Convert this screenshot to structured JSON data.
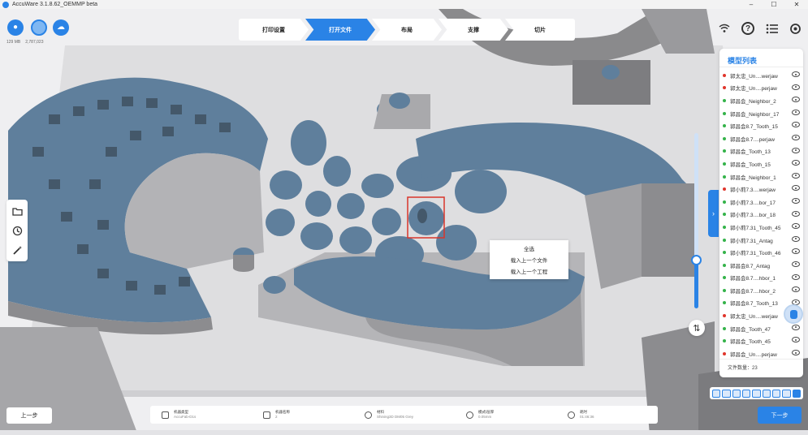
{
  "window": {
    "title": "AccuWare 3.1.8.62_OEMMP beta",
    "controls": [
      "–",
      "☐",
      "✕"
    ]
  },
  "account": {
    "memory": "129 MB",
    "triangles": "2,787,023"
  },
  "steps": [
    {
      "label": "打印设置",
      "active": false
    },
    {
      "label": "打开文件",
      "active": true
    },
    {
      "label": "布局",
      "active": false
    },
    {
      "label": "支撑",
      "active": false
    },
    {
      "label": "切片",
      "active": false
    }
  ],
  "top_right_icons": [
    "wifi-icon",
    "help-icon",
    "list-icon",
    "settings-icon"
  ],
  "left_tools": [
    "folder-icon",
    "history-icon",
    "magic-wand-icon"
  ],
  "context_menu": {
    "items": [
      "全选",
      "载入上一个文件",
      "载入上一个工程"
    ]
  },
  "model_list": {
    "title": "模型列表",
    "items": [
      {
        "name": "郭太忠_Un....werjaw",
        "status": "red"
      },
      {
        "name": "郭太忠_Un....perjaw",
        "status": "red"
      },
      {
        "name": "郭昌会_Neighbor_2",
        "status": "green"
      },
      {
        "name": "郭昌会_Neighbor_17",
        "status": "green"
      },
      {
        "name": "郭昌会8.7_Tooth_15",
        "status": "green"
      },
      {
        "name": "郭昌会8.7....perjaw",
        "status": "green"
      },
      {
        "name": "郭昌会_Tooth_13",
        "status": "green"
      },
      {
        "name": "郭昌会_Tooth_15",
        "status": "green"
      },
      {
        "name": "郭昌会_Neighbor_1",
        "status": "green"
      },
      {
        "name": "郭小莉7.3....werjaw",
        "status": "red"
      },
      {
        "name": "郭小莉7.3....bor_17",
        "status": "green"
      },
      {
        "name": "郭小莉7.3....bor_18",
        "status": "green"
      },
      {
        "name": "郭小莉7.31_Tooth_45",
        "status": "green"
      },
      {
        "name": "郭小莉7.31_Antag",
        "status": "green"
      },
      {
        "name": "郭小莉7.31_Tooth_46",
        "status": "green"
      },
      {
        "name": "郭昌会8.7_Antag",
        "status": "green"
      },
      {
        "name": "郭昌会8.7....hbor_1",
        "status": "green"
      },
      {
        "name": "郭昌会8.7....hbor_2",
        "status": "green"
      },
      {
        "name": "郭昌会8.7_Tooth_13",
        "status": "green"
      },
      {
        "name": "郭太忠_Un....werjaw",
        "status": "red"
      },
      {
        "name": "郭昌会_Tooth_47",
        "status": "green"
      },
      {
        "name": "郭昌会_Tooth_45",
        "status": "green"
      },
      {
        "name": "郭昌会_Un....perjaw",
        "status": "red"
      }
    ],
    "file_count_label": "文件数量：23"
  },
  "layer_slider": {
    "level": 0.28
  },
  "bottom": {
    "prev_label": "上一步",
    "next_label": "下一步",
    "info": [
      {
        "icon": "printer-icon",
        "label": "机器类型",
        "value": "AccuFab-D1s"
      },
      {
        "icon": "grid-icon",
        "label": "机器名称",
        "value": "2"
      },
      {
        "icon": "drop-icon",
        "label": "材料",
        "value": "Shining3D DM05 Grey"
      },
      {
        "icon": "layers-icon",
        "label": "模式/层厚",
        "value": "0.05mm"
      },
      {
        "icon": "clock-icon",
        "label": "耗时",
        "value": "01:46:36"
      }
    ]
  },
  "colors": {
    "accent": "#2a83e6",
    "model": "#5f7f9c",
    "model_side": "#9a9a9a",
    "plate": "#d9d9db"
  }
}
